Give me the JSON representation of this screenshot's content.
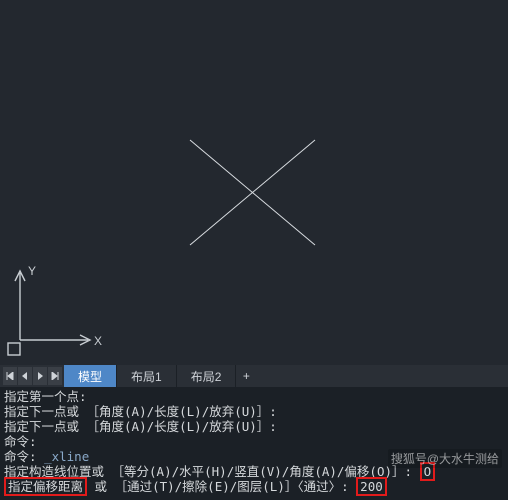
{
  "axis": {
    "x_label": "X",
    "y_label": "Y"
  },
  "tabs": {
    "model": "模型",
    "layout1": "布局1",
    "layout2": "布局2",
    "plus": "+"
  },
  "cmd": {
    "l1": "指定第一个点:",
    "l2": "指定下一点或 ［角度(A)/长度(L)/放弃(U)］:",
    "l3": "指定下一点或 ［角度(A)/长度(L)/放弃(U)］:",
    "l4": "命令:",
    "l5_a": "命令: ",
    "l5_b": "_xline",
    "l6_a": "指定构造线位置或 ［等分(A)/水平(H)/竖直(V)/角度(A)/偏移(O)］: ",
    "l6_box": "O",
    "l7_a": "指定偏移距离",
    "l7_b": "或 ［通过(T)/擦除(E)/图层(L)］〈通过〉: ",
    "l7_box": "200"
  },
  "watermark": "搜狐号@大水牛测给"
}
